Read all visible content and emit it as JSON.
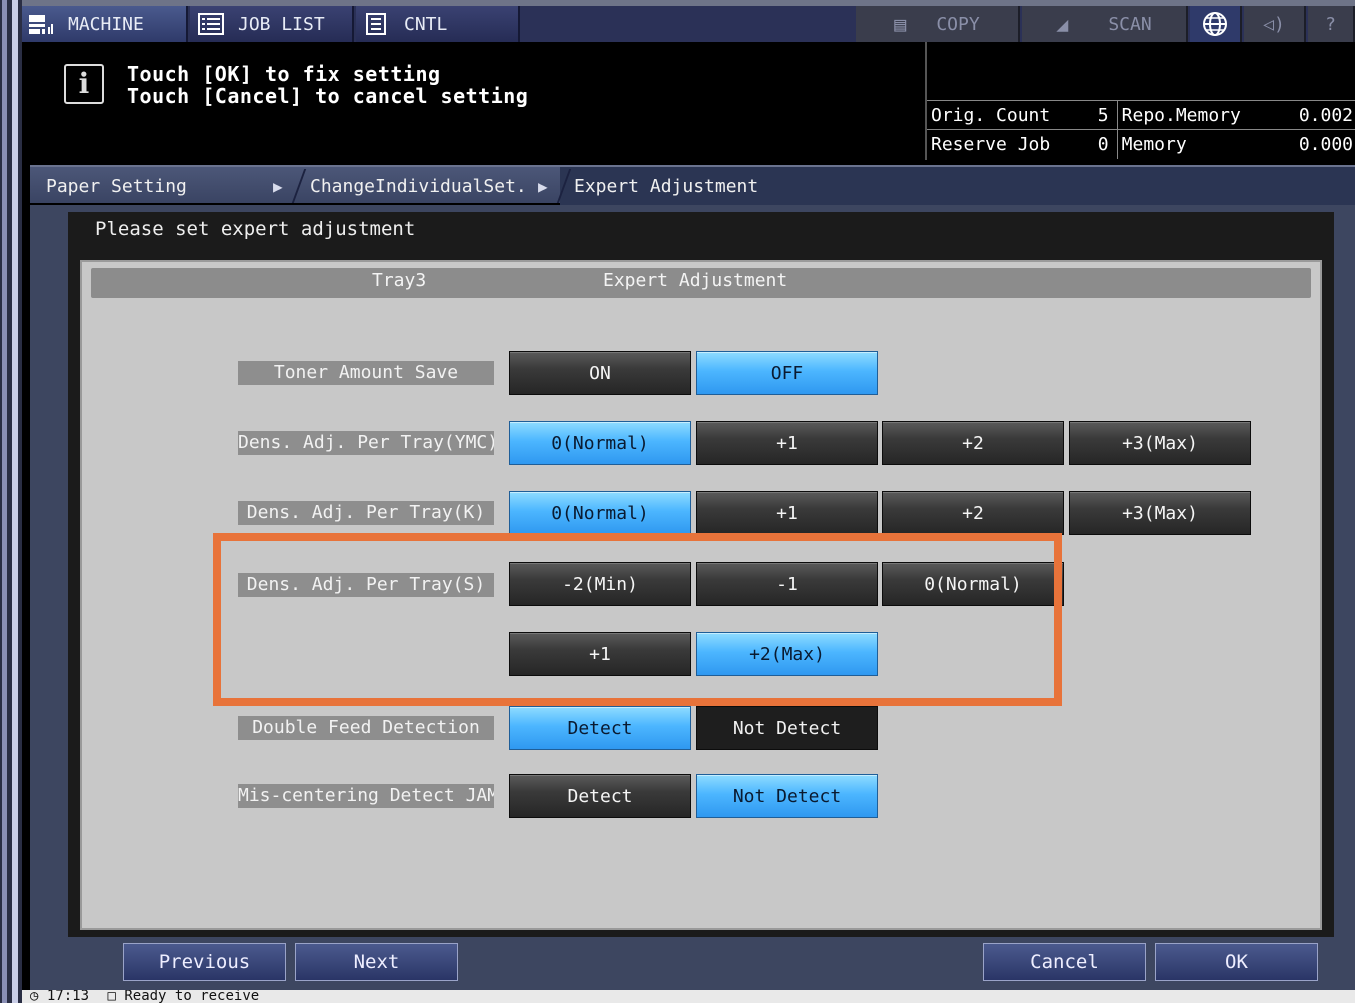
{
  "tabs": {
    "machine": "MACHINE",
    "job_list": "JOB LIST",
    "cntl": "CNTL",
    "copy": "COPY",
    "scan": "SCAN",
    "help": "?"
  },
  "message": {
    "line1": "Touch [OK] to fix setting",
    "line2": "Touch [Cancel] to cancel setting"
  },
  "counters": {
    "orig_count_label": "Orig. Count",
    "orig_count_value": "5",
    "repo_memory_label": "Repo.Memory",
    "repo_memory_value": "0.002",
    "reserve_job_label": "Reserve Job",
    "reserve_job_value": "0",
    "memory_label": "Memory",
    "memory_value": "0.000"
  },
  "breadcrumb": {
    "item1": "Paper Setting",
    "item2": "ChangeIndividualSet.",
    "item3": "Expert Adjustment"
  },
  "instruction": "Please set expert adjustment",
  "panel": {
    "tray": "Tray3",
    "title": "Expert Adjustment"
  },
  "rows": {
    "toner": {
      "label": "Toner Amount Save",
      "options": [
        "ON",
        "OFF"
      ],
      "selected": "OFF"
    },
    "ymc": {
      "label": "Dens. Adj. Per Tray(YMC)",
      "options": [
        "0(Normal)",
        "+1",
        "+2",
        "+3(Max)"
      ],
      "selected": "0(Normal)"
    },
    "k": {
      "label": "Dens. Adj. Per Tray(K)",
      "options": [
        "0(Normal)",
        "+1",
        "+2",
        "+3(Max)"
      ],
      "selected": "0(Normal)"
    },
    "s": {
      "label": "Dens. Adj. Per Tray(S)",
      "options": [
        "-2(Min)",
        "-1",
        "0(Normal)",
        "+1",
        "+2(Max)"
      ],
      "selected": "+2(Max)"
    },
    "double_feed": {
      "label": "Double Feed Detection",
      "options": [
        "Detect",
        "Not Detect"
      ],
      "selected": "Detect"
    },
    "mis_centering": {
      "label": "Mis-centering Detect JAM",
      "options": [
        "Detect",
        "Not Detect"
      ],
      "selected": "Not Detect"
    }
  },
  "nav": {
    "previous": "Previous",
    "next": "Next",
    "cancel": "Cancel",
    "ok": "OK"
  },
  "status": {
    "time": "17:13",
    "text": "Ready to receive"
  },
  "colors": {
    "selected": "#4cb6ff",
    "highlight_box": "#e8733a",
    "nav": "#2a3566"
  }
}
